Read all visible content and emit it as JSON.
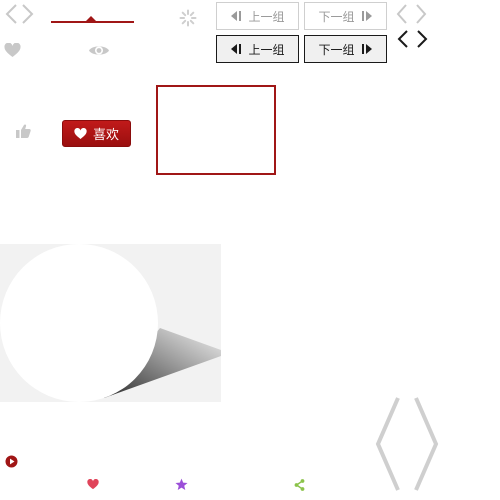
{
  "buttons": {
    "prev_group_label": "上一组",
    "next_group_label": "下一组",
    "like_label": "喜欢"
  },
  "colors": {
    "accent_red": "#a01616",
    "gray_icon": "#c8c8c8",
    "heart_pink": "#e0445a",
    "star_purple": "#9b4fd8",
    "share_green": "#8bc34a"
  },
  "icons": [
    "chevron-left-icon",
    "chevron-right-icon",
    "spinner-icon",
    "heart-icon",
    "eye-icon",
    "thumbs-up-icon",
    "play-icon",
    "star-icon",
    "share-icon"
  ]
}
